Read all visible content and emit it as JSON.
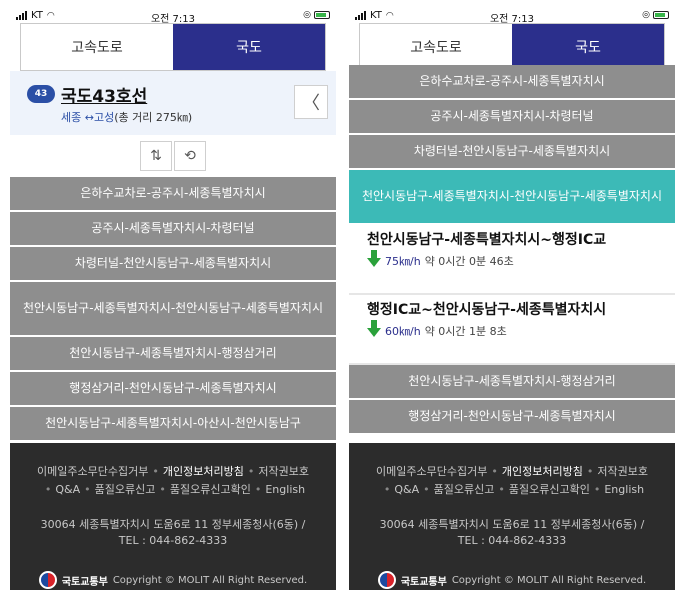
{
  "status": {
    "carrier": "KT",
    "time": "오전 7:13"
  },
  "tabs": [
    "고속도로",
    "국도"
  ],
  "route": {
    "badge": "43",
    "name": "국도43호선",
    "origin_dest": "세종 ↔고성",
    "length": "(총 거리 275㎞)"
  },
  "panel1_segments": [
    "은하수교차로-공주시-세종특별자치시",
    "공주시-세종특별자치시-차령터널",
    "차령터널-천안시동남구-세종특별자치시",
    "천안시동남구-세종특별자치시-천안시동남구-세종특별자치시",
    "천안시동남구-세종특별자치시-행정삼거리",
    "행정삼거리-천안시동남구-세종특별자치시",
    "천안시동남구-세종특별자치시-아산시-천안시동남구"
  ],
  "panel2_top_segments": [
    "은하수교차로-공주시-세종특별자치시",
    "공주시-세종특별자치시-차령터널",
    "차령터널-천안시동남구-세종특별자치시"
  ],
  "panel2_active_segment": "천안시동남구-세종특별자치시-천안시동남구-세종특별자치시",
  "details": [
    {
      "title": "천안시동남구-세종특별자치시~행정IC교",
      "speed": "75㎞/h",
      "rest": "약 0시간 0분 46초"
    },
    {
      "title": "행정IC교~천안시동남구-세종특별자치시",
      "speed": "60㎞/h",
      "rest": "약 0시간 1분 8초"
    }
  ],
  "panel2_bottom_segments": [
    "천안시동남구-세종특별자치시-행정삼거리",
    "행정삼거리-천안시동남구-세종특별자치시"
  ],
  "footer": {
    "link1": "이메일주소무단수집거부",
    "link2": "개인정보처리방침",
    "link3": "저작권보호",
    "link4": "Q&A",
    "link5": "품질오류신고",
    "link6": "품질오류신고확인",
    "link7": "English",
    "address": "30064 세종특별자치시 도움6로 11 정부세종청사(6동) /",
    "tel": "TEL : 044-862-4333",
    "logo": "국토교통부",
    "copyright": "Copyright © MOLIT All Right Reserved."
  }
}
